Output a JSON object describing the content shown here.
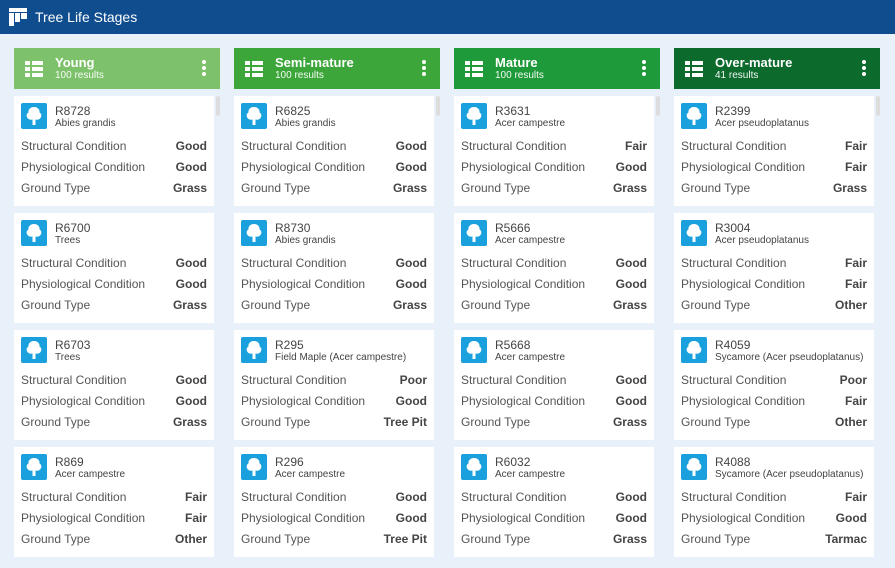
{
  "app": {
    "title": "Tree Life Stages"
  },
  "labels": {
    "structural": "Structural Condition",
    "physiological": "Physiological Condition",
    "ground": "Ground Type"
  },
  "columns": [
    {
      "title": "Young",
      "count": "100 results",
      "color": "#7dc26a",
      "cards": [
        {
          "id": "R8728",
          "species": "Abies grandis",
          "structural": "Good",
          "physiological": "Good",
          "ground": "Grass"
        },
        {
          "id": "R6700",
          "species": "Trees",
          "structural": "Good",
          "physiological": "Good",
          "ground": "Grass"
        },
        {
          "id": "R6703",
          "species": "Trees",
          "structural": "Good",
          "physiological": "Good",
          "ground": "Grass"
        },
        {
          "id": "R869",
          "species": "Acer campestre",
          "structural": "Fair",
          "physiological": "Fair",
          "ground": "Other"
        }
      ]
    },
    {
      "title": "Semi-mature",
      "count": "100 results",
      "color": "#3da63b",
      "cards": [
        {
          "id": "R6825",
          "species": "Abies grandis",
          "structural": "Good",
          "physiological": "Good",
          "ground": "Grass"
        },
        {
          "id": "R8730",
          "species": "Abies grandis",
          "structural": "Good",
          "physiological": "Good",
          "ground": "Grass"
        },
        {
          "id": "R295",
          "species": "Field Maple (Acer campestre)",
          "structural": "Poor",
          "physiological": "Good",
          "ground": "Tree Pit"
        },
        {
          "id": "R296",
          "species": "Acer campestre",
          "structural": "Good",
          "physiological": "Good",
          "ground": "Tree Pit"
        }
      ]
    },
    {
      "title": "Mature",
      "count": "100 results",
      "color": "#1f9a3a",
      "cards": [
        {
          "id": "R3631",
          "species": "Acer campestre",
          "structural": "Fair",
          "physiological": "Good",
          "ground": "Grass"
        },
        {
          "id": "R5666",
          "species": "Acer campestre",
          "structural": "Good",
          "physiological": "Good",
          "ground": "Grass"
        },
        {
          "id": "R5668",
          "species": "Acer campestre",
          "structural": "Good",
          "physiological": "Good",
          "ground": "Grass"
        },
        {
          "id": "R6032",
          "species": "Acer campestre",
          "structural": "Good",
          "physiological": "Good",
          "ground": "Grass"
        }
      ]
    },
    {
      "title": "Over-mature",
      "count": "41 results",
      "color": "#0b6a2c",
      "cards": [
        {
          "id": "R2399",
          "species": "Acer pseudoplatanus",
          "structural": "Fair",
          "physiological": "Fair",
          "ground": "Grass"
        },
        {
          "id": "R3004",
          "species": "Acer pseudoplatanus",
          "structural": "Fair",
          "physiological": "Fair",
          "ground": "Other"
        },
        {
          "id": "R4059",
          "species": "Sycamore (Acer pseudoplatanus)",
          "structural": "Poor",
          "physiological": "Fair",
          "ground": "Other"
        },
        {
          "id": "R4088",
          "species": "Sycamore (Acer pseudoplatanus)",
          "structural": "Fair",
          "physiological": "Good",
          "ground": "Tarmac"
        }
      ]
    }
  ]
}
